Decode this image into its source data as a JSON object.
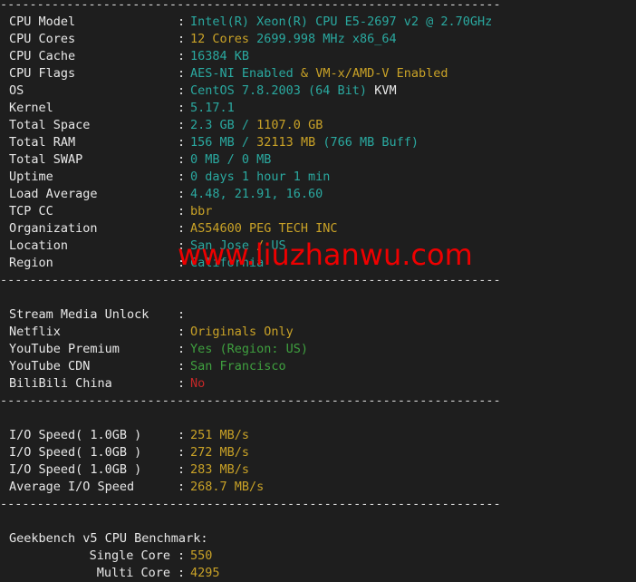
{
  "terminal": {
    "separator_text": "--------------------------------------------------------------------",
    "watermark": "www.liuzhanwu.com",
    "colon": ":",
    "colors": {
      "background": "#1e1e1e",
      "label": "#e8e8e8",
      "teal": "#2aa9a0",
      "yellow": "#c9a227",
      "green": "#3fa03f",
      "red": "#c62828",
      "watermark": "#ee0000"
    }
  },
  "system_info": [
    {
      "label": "CPU Model",
      "value": "Intel(R) Xeon(R) CPU E5-2697 v2 @ 2.70GHz",
      "color": "teal"
    },
    {
      "label": "CPU Cores",
      "value": "12 Cores 2699.998 MHz x86_64",
      "color": "mixed"
    },
    {
      "label": "CPU Cache",
      "value": "16384 KB",
      "color": "teal"
    },
    {
      "label": "CPU Flags",
      "value": "AES-NI Enabled & VM-x/AMD-V Enabled",
      "color": "mixed"
    },
    {
      "label": "OS",
      "value": "CentOS 7.8.2003 (64 Bit) KVM",
      "color": "mixed"
    },
    {
      "label": "Kernel",
      "value": "5.17.1",
      "color": "teal"
    },
    {
      "label": "Total Space",
      "value": "2.3 GB / 1107.0 GB",
      "color": "mixed"
    },
    {
      "label": "Total RAM",
      "value": "156 MB / 32113 MB (766 MB Buff)",
      "color": "mixed"
    },
    {
      "label": "Total SWAP",
      "value": "0 MB / 0 MB",
      "color": "teal"
    },
    {
      "label": "Uptime",
      "value": "0 days 1 hour 1 min",
      "color": "teal"
    },
    {
      "label": "Load Average",
      "value": "4.48, 21.91, 16.60",
      "color": "teal"
    },
    {
      "label": "TCP CC",
      "value": "bbr",
      "color": "yellow"
    },
    {
      "label": "Organization",
      "value": "AS54600 PEG TECH INC",
      "color": "yellow"
    },
    {
      "label": "Location",
      "value": "San Jose / US",
      "color": "mixed"
    },
    {
      "label": "Region",
      "value": "California",
      "color": "teal"
    }
  ],
  "cpu_cores_parts": {
    "cores": "12 Cores",
    "rest": " 2699.998 MHz x86_64"
  },
  "cpu_flags_parts": {
    "aes": "AES-NI Enabled ",
    "amp": "& ",
    "vmx": "VM-x/AMD-V Enabled"
  },
  "os_parts": {
    "distro": "CentOS 7.8.2003 (64 Bit) ",
    "virt": "KVM"
  },
  "space_parts": {
    "used": "2.3 GB",
    "slash": " / ",
    "total": "1107.0 GB"
  },
  "ram_parts": {
    "used": "156 MB",
    "slash": " / ",
    "total": "32113 MB",
    "buff": " (766 MB Buff)"
  },
  "location_parts": {
    "city": "San Jose ",
    "slash": "/ ",
    "country": "US"
  },
  "stream_media": {
    "header_label": "Stream Media Unlock",
    "header_value": "",
    "items": [
      {
        "label": "Netflix",
        "value": "Originals Only",
        "color": "yellow"
      },
      {
        "label": "YouTube Premium",
        "value": "Yes (Region: US)",
        "color": "green"
      },
      {
        "label": "YouTube CDN",
        "value": "San Francisco",
        "color": "green"
      },
      {
        "label": "BiliBili China",
        "value": "No",
        "color": "red"
      }
    ]
  },
  "io_speed": {
    "items": [
      {
        "label": "I/O Speed( 1.0GB )",
        "value": "251 MB/s",
        "color": "yellow"
      },
      {
        "label": "I/O Speed( 1.0GB )",
        "value": "272 MB/s",
        "color": "yellow"
      },
      {
        "label": "I/O Speed( 1.0GB )",
        "value": "283 MB/s",
        "color": "yellow"
      },
      {
        "label": "Average I/O Speed",
        "value": "268.7 MB/s",
        "color": "yellow"
      }
    ]
  },
  "geekbench": {
    "title": "Geekbench v5 CPU Benchmark:",
    "items": [
      {
        "label": "Single Core",
        "value": "550",
        "color": "yellow"
      },
      {
        "label": "Multi Core",
        "value": "4295",
        "color": "yellow"
      }
    ]
  }
}
